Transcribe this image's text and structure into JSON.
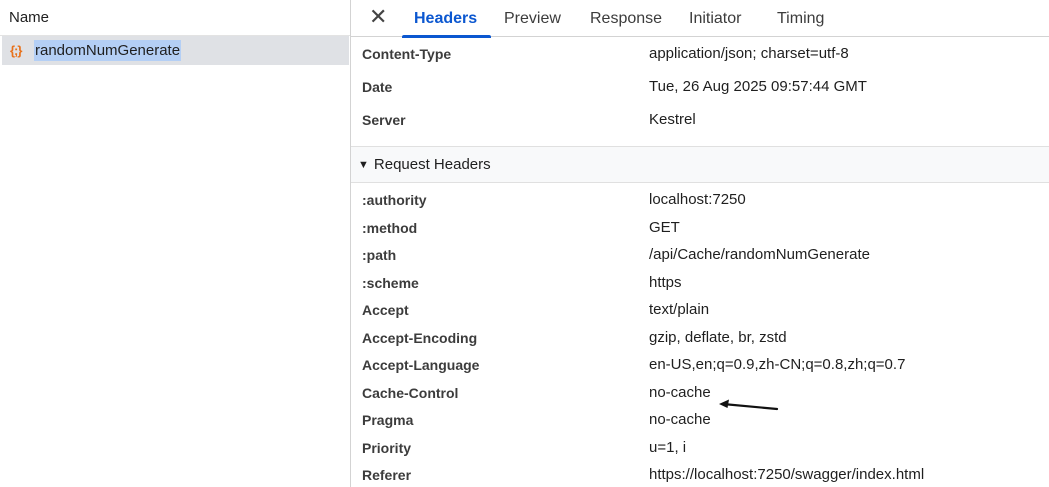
{
  "request_list": {
    "column_name": "Name",
    "items": [
      {
        "icon": "json-braces-icon",
        "icon_glyph": "{;}",
        "name": "randomNumGenerate",
        "selected": true
      }
    ]
  },
  "tabs": {
    "items": [
      {
        "label": "Headers",
        "active": true
      },
      {
        "label": "Preview",
        "active": false
      },
      {
        "label": "Response",
        "active": false
      },
      {
        "label": "Initiator",
        "active": false
      },
      {
        "label": "Timing",
        "active": false
      }
    ]
  },
  "response_headers": [
    {
      "name": "Content-Type",
      "value": "application/json; charset=utf-8"
    },
    {
      "name": "Date",
      "value": "Tue, 26 Aug 2025 09:57:44 GMT"
    },
    {
      "name": "Server",
      "value": "Kestrel"
    }
  ],
  "request_headers": {
    "title": "Request Headers",
    "expanded": true,
    "items": [
      {
        "name": ":authority",
        "value": "localhost:7250"
      },
      {
        "name": ":method",
        "value": "GET"
      },
      {
        "name": ":path",
        "value": "/api/Cache/randomNumGenerate"
      },
      {
        "name": ":scheme",
        "value": "https"
      },
      {
        "name": "Accept",
        "value": "text/plain"
      },
      {
        "name": "Accept-Encoding",
        "value": "gzip, deflate, br, zstd"
      },
      {
        "name": "Accept-Language",
        "value": "en-US,en;q=0.9,zh-CN;q=0.8,zh;q=0.7"
      },
      {
        "name": "Cache-Control",
        "value": "no-cache"
      },
      {
        "name": "Pragma",
        "value": "no-cache"
      },
      {
        "name": "Priority",
        "value": "u=1, i"
      },
      {
        "name": "Referer",
        "value": "https://localhost:7250/swagger/index.html"
      }
    ]
  },
  "colors": {
    "accent": "#0b57d0",
    "selection": "#b4cff5",
    "selected_row": "#dfe1e5",
    "json_icon": "#e8711a"
  }
}
